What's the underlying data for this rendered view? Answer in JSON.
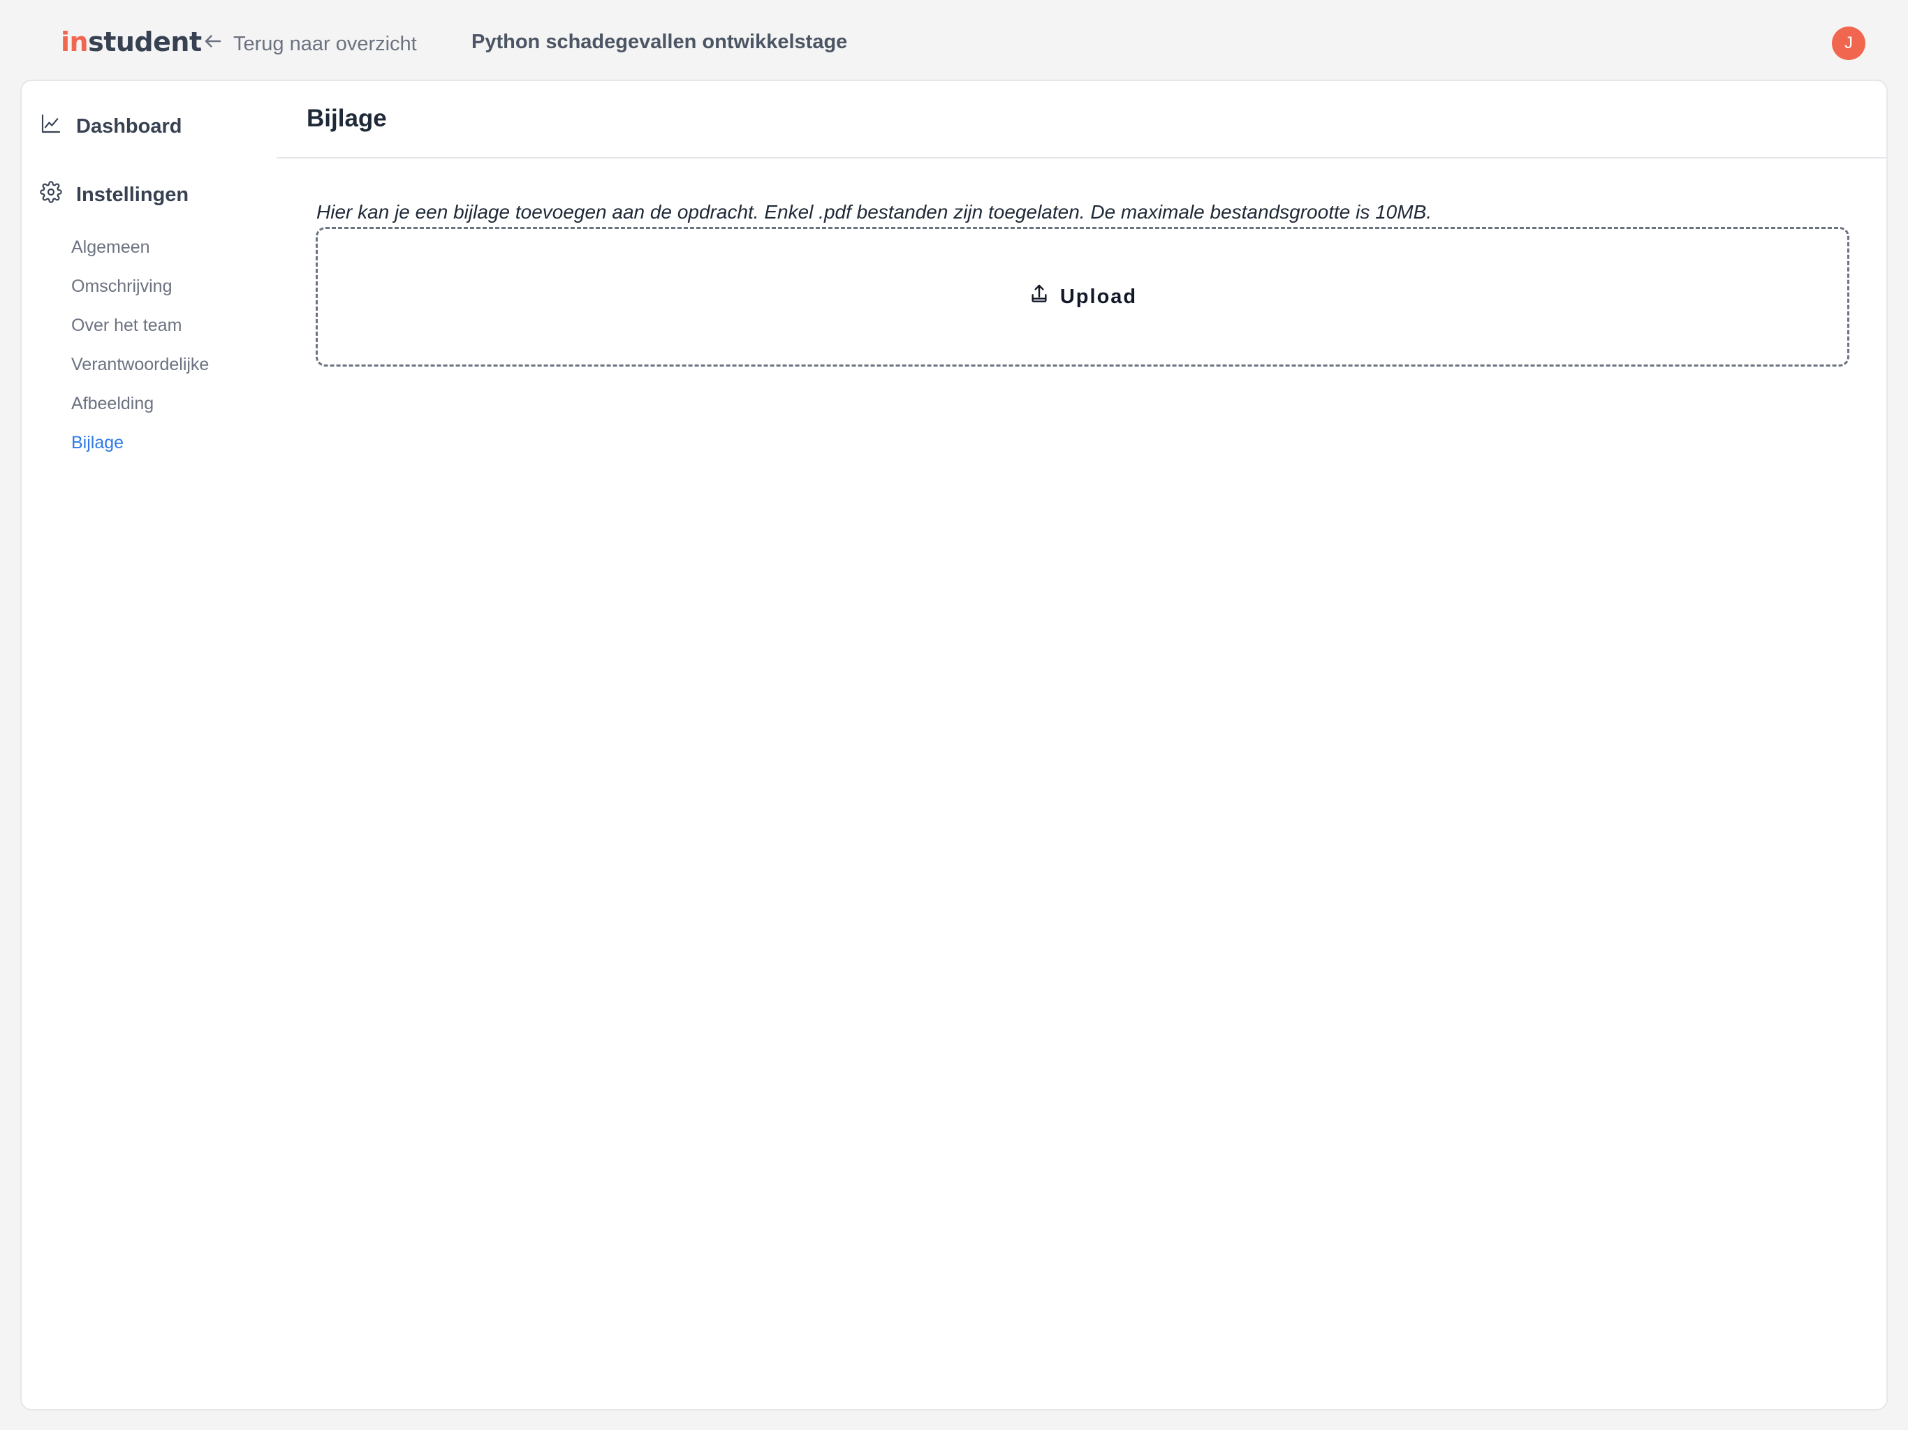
{
  "header": {
    "logo_accent": "in",
    "logo_rest": "student",
    "back_label": "Terug naar overzicht",
    "project_title": "Python schadegevallen ontwikkelstage",
    "avatar_initial": "J",
    "accent_color": "#f0664f"
  },
  "sidebar": {
    "dashboard_label": "Dashboard",
    "dashboard_icon": "chart-line-icon",
    "settings_label": "Instellingen",
    "settings_icon": "gear-icon",
    "items": [
      {
        "label": "Algemeen"
      },
      {
        "label": "Omschrijving"
      },
      {
        "label": "Over het team"
      },
      {
        "label": "Verantwoordelijke"
      },
      {
        "label": "Afbeelding"
      },
      {
        "label": "Bijlage",
        "active": true
      }
    ],
    "active_color": "#2f7ae5"
  },
  "main": {
    "title": "Bijlage",
    "hint": "Hier kan je een bijlage toevoegen aan de opdracht. Enkel .pdf bestanden zijn toegelaten. De maximale bestandsgrootte is 10MB.",
    "upload_label": "Upload",
    "upload_icon": "upload-icon"
  }
}
